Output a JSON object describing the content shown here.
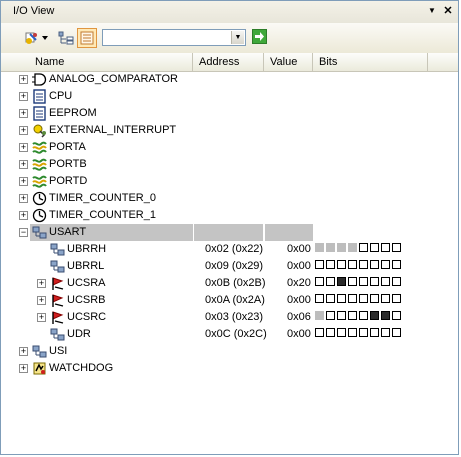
{
  "window": {
    "title": "I/O View"
  },
  "title_buttons": {
    "dropdown": "▼",
    "close": "✕"
  },
  "toolbar": {
    "combo_value": "",
    "colors": {
      "go": "#3fa83a",
      "pressed_bg": "#ffe9b6"
    }
  },
  "columns": {
    "name": "Name",
    "address": "Address",
    "value": "Value",
    "bits": "Bits"
  },
  "tree": [
    {
      "name": "ANALOG_COMPARATOR",
      "expander": "+",
      "icon": "comparator-icon"
    },
    {
      "name": "CPU",
      "expander": "+",
      "icon": "cpu-icon"
    },
    {
      "name": "EEPROM",
      "expander": "+",
      "icon": "eeprom-icon"
    },
    {
      "name": "EXTERNAL_INTERRUPT",
      "expander": "+",
      "icon": "interrupt-icon"
    },
    {
      "name": "PORTA",
      "expander": "+",
      "icon": "port-icon"
    },
    {
      "name": "PORTB",
      "expander": "+",
      "icon": "port-icon"
    },
    {
      "name": "PORTD",
      "expander": "+",
      "icon": "port-icon"
    },
    {
      "name": "TIMER_COUNTER_0",
      "expander": "+",
      "icon": "timer-icon"
    },
    {
      "name": "TIMER_COUNTER_1",
      "expander": "+",
      "icon": "timer-icon"
    },
    {
      "name": "USART",
      "expander": "−",
      "icon": "usart-icon",
      "selected": true
    },
    {
      "name": "UBRRH",
      "child": true,
      "icon": "register-icon",
      "address": "0x02 (0x22)",
      "value": "0x00",
      "bits": [
        "u",
        "u",
        "u",
        "u",
        "0",
        "0",
        "0",
        "0"
      ]
    },
    {
      "name": "UBRRL",
      "child": true,
      "icon": "register-icon",
      "address": "0x09 (0x29)",
      "value": "0x00",
      "bits": [
        "0",
        "0",
        "0",
        "0",
        "0",
        "0",
        "0",
        "0"
      ]
    },
    {
      "name": "UCSRA",
      "child": true,
      "expander": "+",
      "icon": "flag-register-icon",
      "address": "0x0B (0x2B)",
      "value": "0x20",
      "bits": [
        "0",
        "0",
        "1",
        "0",
        "0",
        "0",
        "0",
        "0"
      ]
    },
    {
      "name": "UCSRB",
      "child": true,
      "expander": "+",
      "icon": "flag-register-icon",
      "address": "0x0A (0x2A)",
      "value": "0x00",
      "bits": [
        "0",
        "0",
        "0",
        "0",
        "0",
        "0",
        "0",
        "0"
      ]
    },
    {
      "name": "UCSRC",
      "child": true,
      "expander": "+",
      "icon": "flag-register-icon",
      "address": "0x03 (0x23)",
      "value": "0x06",
      "bits": [
        "u",
        "0",
        "0",
        "0",
        "0",
        "1",
        "1",
        "0"
      ]
    },
    {
      "name": "UDR",
      "child": true,
      "icon": "register-icon",
      "address": "0x0C (0x2C)",
      "value": "0x00",
      "bits": [
        "0",
        "0",
        "0",
        "0",
        "0",
        "0",
        "0",
        "0"
      ]
    },
    {
      "name": "USI",
      "expander": "+",
      "icon": "usi-icon"
    },
    {
      "name": "WATCHDOG",
      "expander": "+",
      "icon": "watchdog-icon"
    }
  ]
}
